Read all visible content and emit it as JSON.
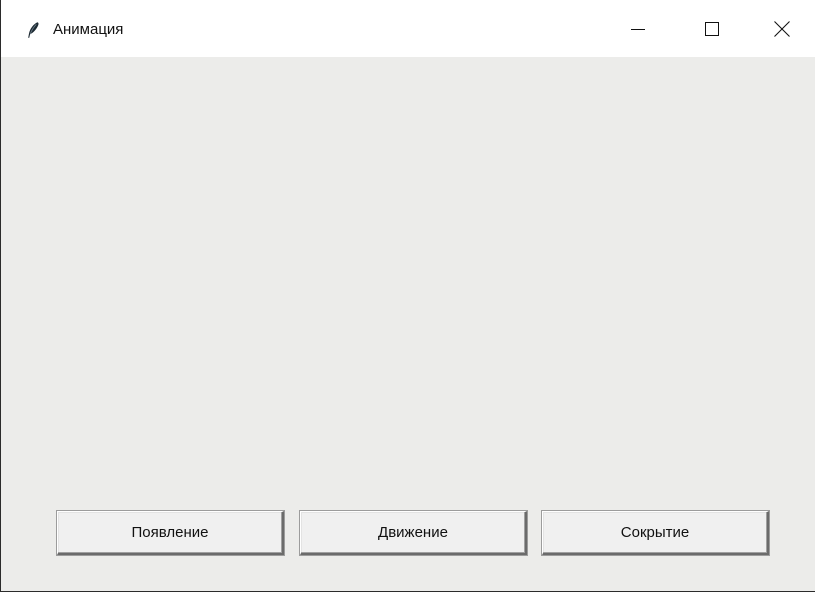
{
  "window": {
    "title": "Анимация",
    "app_icon": "feather-icon",
    "controls": {
      "minimize_icon": "minimize-icon",
      "maximize_icon": "maximize-icon",
      "close_icon": "close-icon"
    }
  },
  "buttons": {
    "appear": "Появление",
    "move": "Движение",
    "hide": "Сокрытие"
  },
  "colors": {
    "titlebar": "#ffffff",
    "client_background": "#ececea",
    "button_face": "#f0f0f0"
  }
}
